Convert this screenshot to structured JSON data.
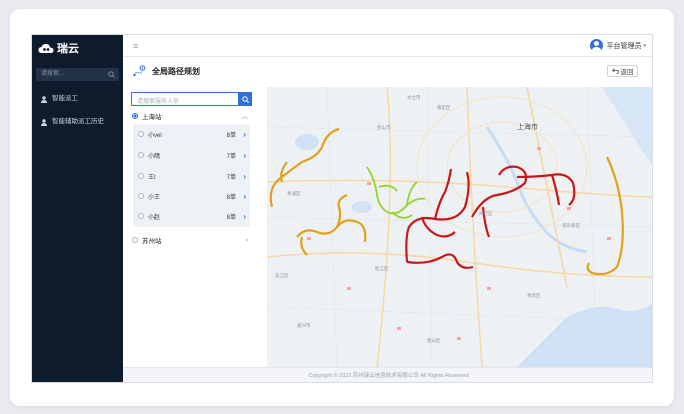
{
  "brand": {
    "name": "瑞云"
  },
  "sidebar": {
    "search_placeholder": "请搜索...",
    "items": [
      {
        "label": "智能派工",
        "icon": "user-icon"
      },
      {
        "label": "智能辅助派工历史",
        "icon": "user-icon"
      }
    ]
  },
  "topbar": {
    "user_label": "平台管理员"
  },
  "page": {
    "title": "全局路径规划",
    "back_label": "返回"
  },
  "panel": {
    "search_placeholder": "请搜索服务人员",
    "groups": [
      {
        "name": "上海站",
        "selected": true,
        "expanded": true,
        "members": [
          {
            "name": "小vel",
            "count": "8单"
          },
          {
            "name": "小隋",
            "count": "7单"
          },
          {
            "name": "王I",
            "count": "7单"
          },
          {
            "name": "小王",
            "count": "8单"
          },
          {
            "name": "小赵",
            "count": "8单"
          }
        ]
      },
      {
        "name": "苏州站",
        "selected": false,
        "expanded": false
      }
    ]
  },
  "map": {
    "city_label": "上海市",
    "labels": [
      "青浦区",
      "松江区",
      "闵行区",
      "嘉定区",
      "浦东新区",
      "奉贤区",
      "金山区",
      "昆山市",
      "太仓市",
      "嘉兴市",
      "吴江区"
    ],
    "route_colors": [
      "#e0a21c",
      "#94d327",
      "#c8171b"
    ]
  },
  "footer": {
    "copyright": "Copyright © 2022 苏州瑞云信息技术有限公司 All Rights Reserved"
  }
}
